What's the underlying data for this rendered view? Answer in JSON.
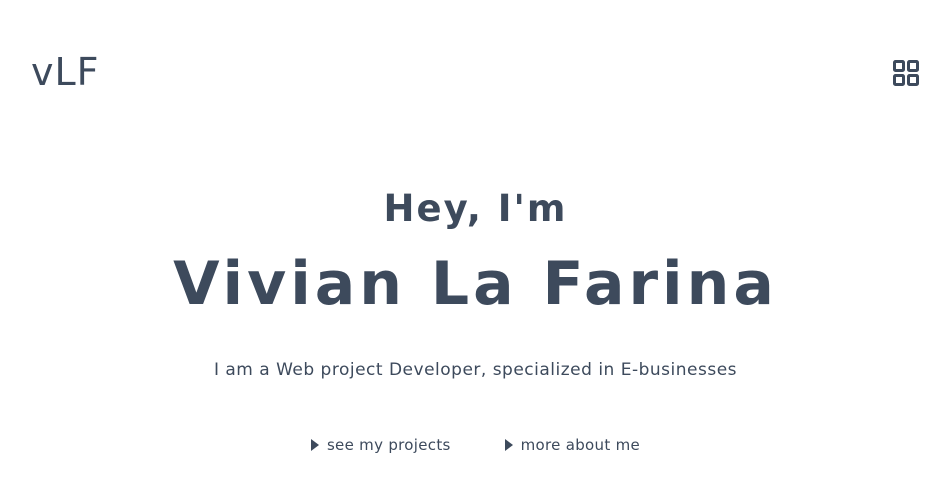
{
  "header": {
    "logo_text": "vLF",
    "menu_icon": "grid-menu-icon"
  },
  "hero": {
    "greeting": "Hey, I'm",
    "name": "Vivian La Farina",
    "tagline": "I am a Web project Developer, specialized in E-businesses"
  },
  "actions": [
    {
      "label": "see my projects",
      "icon": "play-arrow-icon"
    },
    {
      "label": "more about me",
      "icon": "play-arrow-icon"
    }
  ],
  "colors": {
    "text": "#3d4a5c",
    "background": "#ffffff"
  }
}
